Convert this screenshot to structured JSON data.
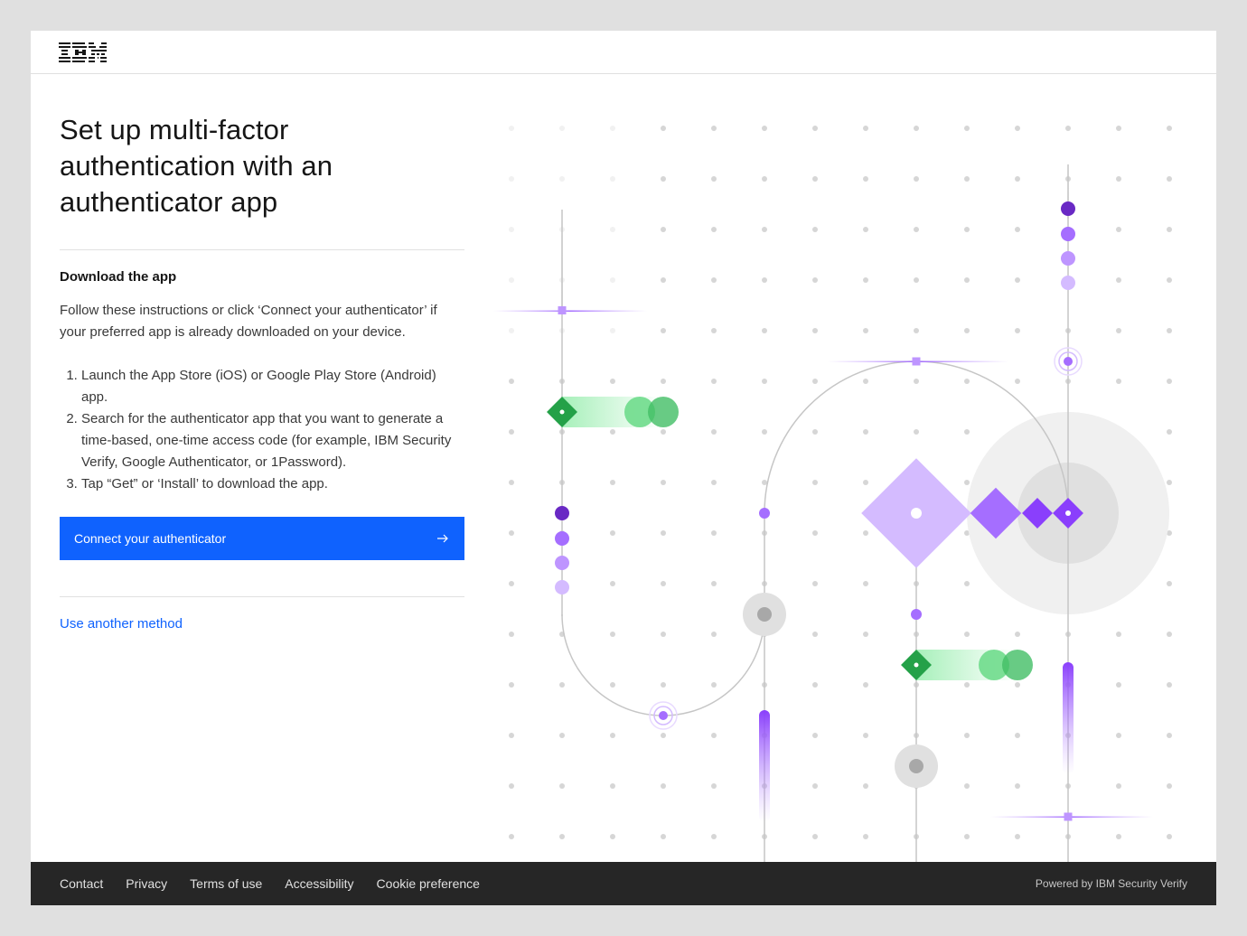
{
  "header": {
    "logo_alt": "IBM"
  },
  "main": {
    "title": "Set up multi-factor authentication with an authenticator app",
    "section_title": "Download the app",
    "intro": "Follow these instructions or click ‘Connect your authenticator’ if your preferred app is already downloaded on your device.",
    "steps": [
      "Launch the App Store (iOS) or Google Play Store (Android) app.",
      "Search for the authenticator app that you want to generate a time-based, one-time access code (for example, IBM Security Verify, Google Authenticator, or 1Password).",
      "Tap “Get” or ‘Install’ to download the app."
    ],
    "connect_button": "Connect your authenticator",
    "other_method_link": "Use another method"
  },
  "footer": {
    "links": [
      "Contact",
      "Privacy",
      "Terms of use",
      "Accessibility",
      "Cookie preference"
    ],
    "powered_by": "Powered by IBM Security Verify"
  },
  "colors": {
    "primary": "#0f62fe",
    "footer_bg": "#262626",
    "accent_purple": "#8a3ffc",
    "accent_green": "#24a148"
  }
}
